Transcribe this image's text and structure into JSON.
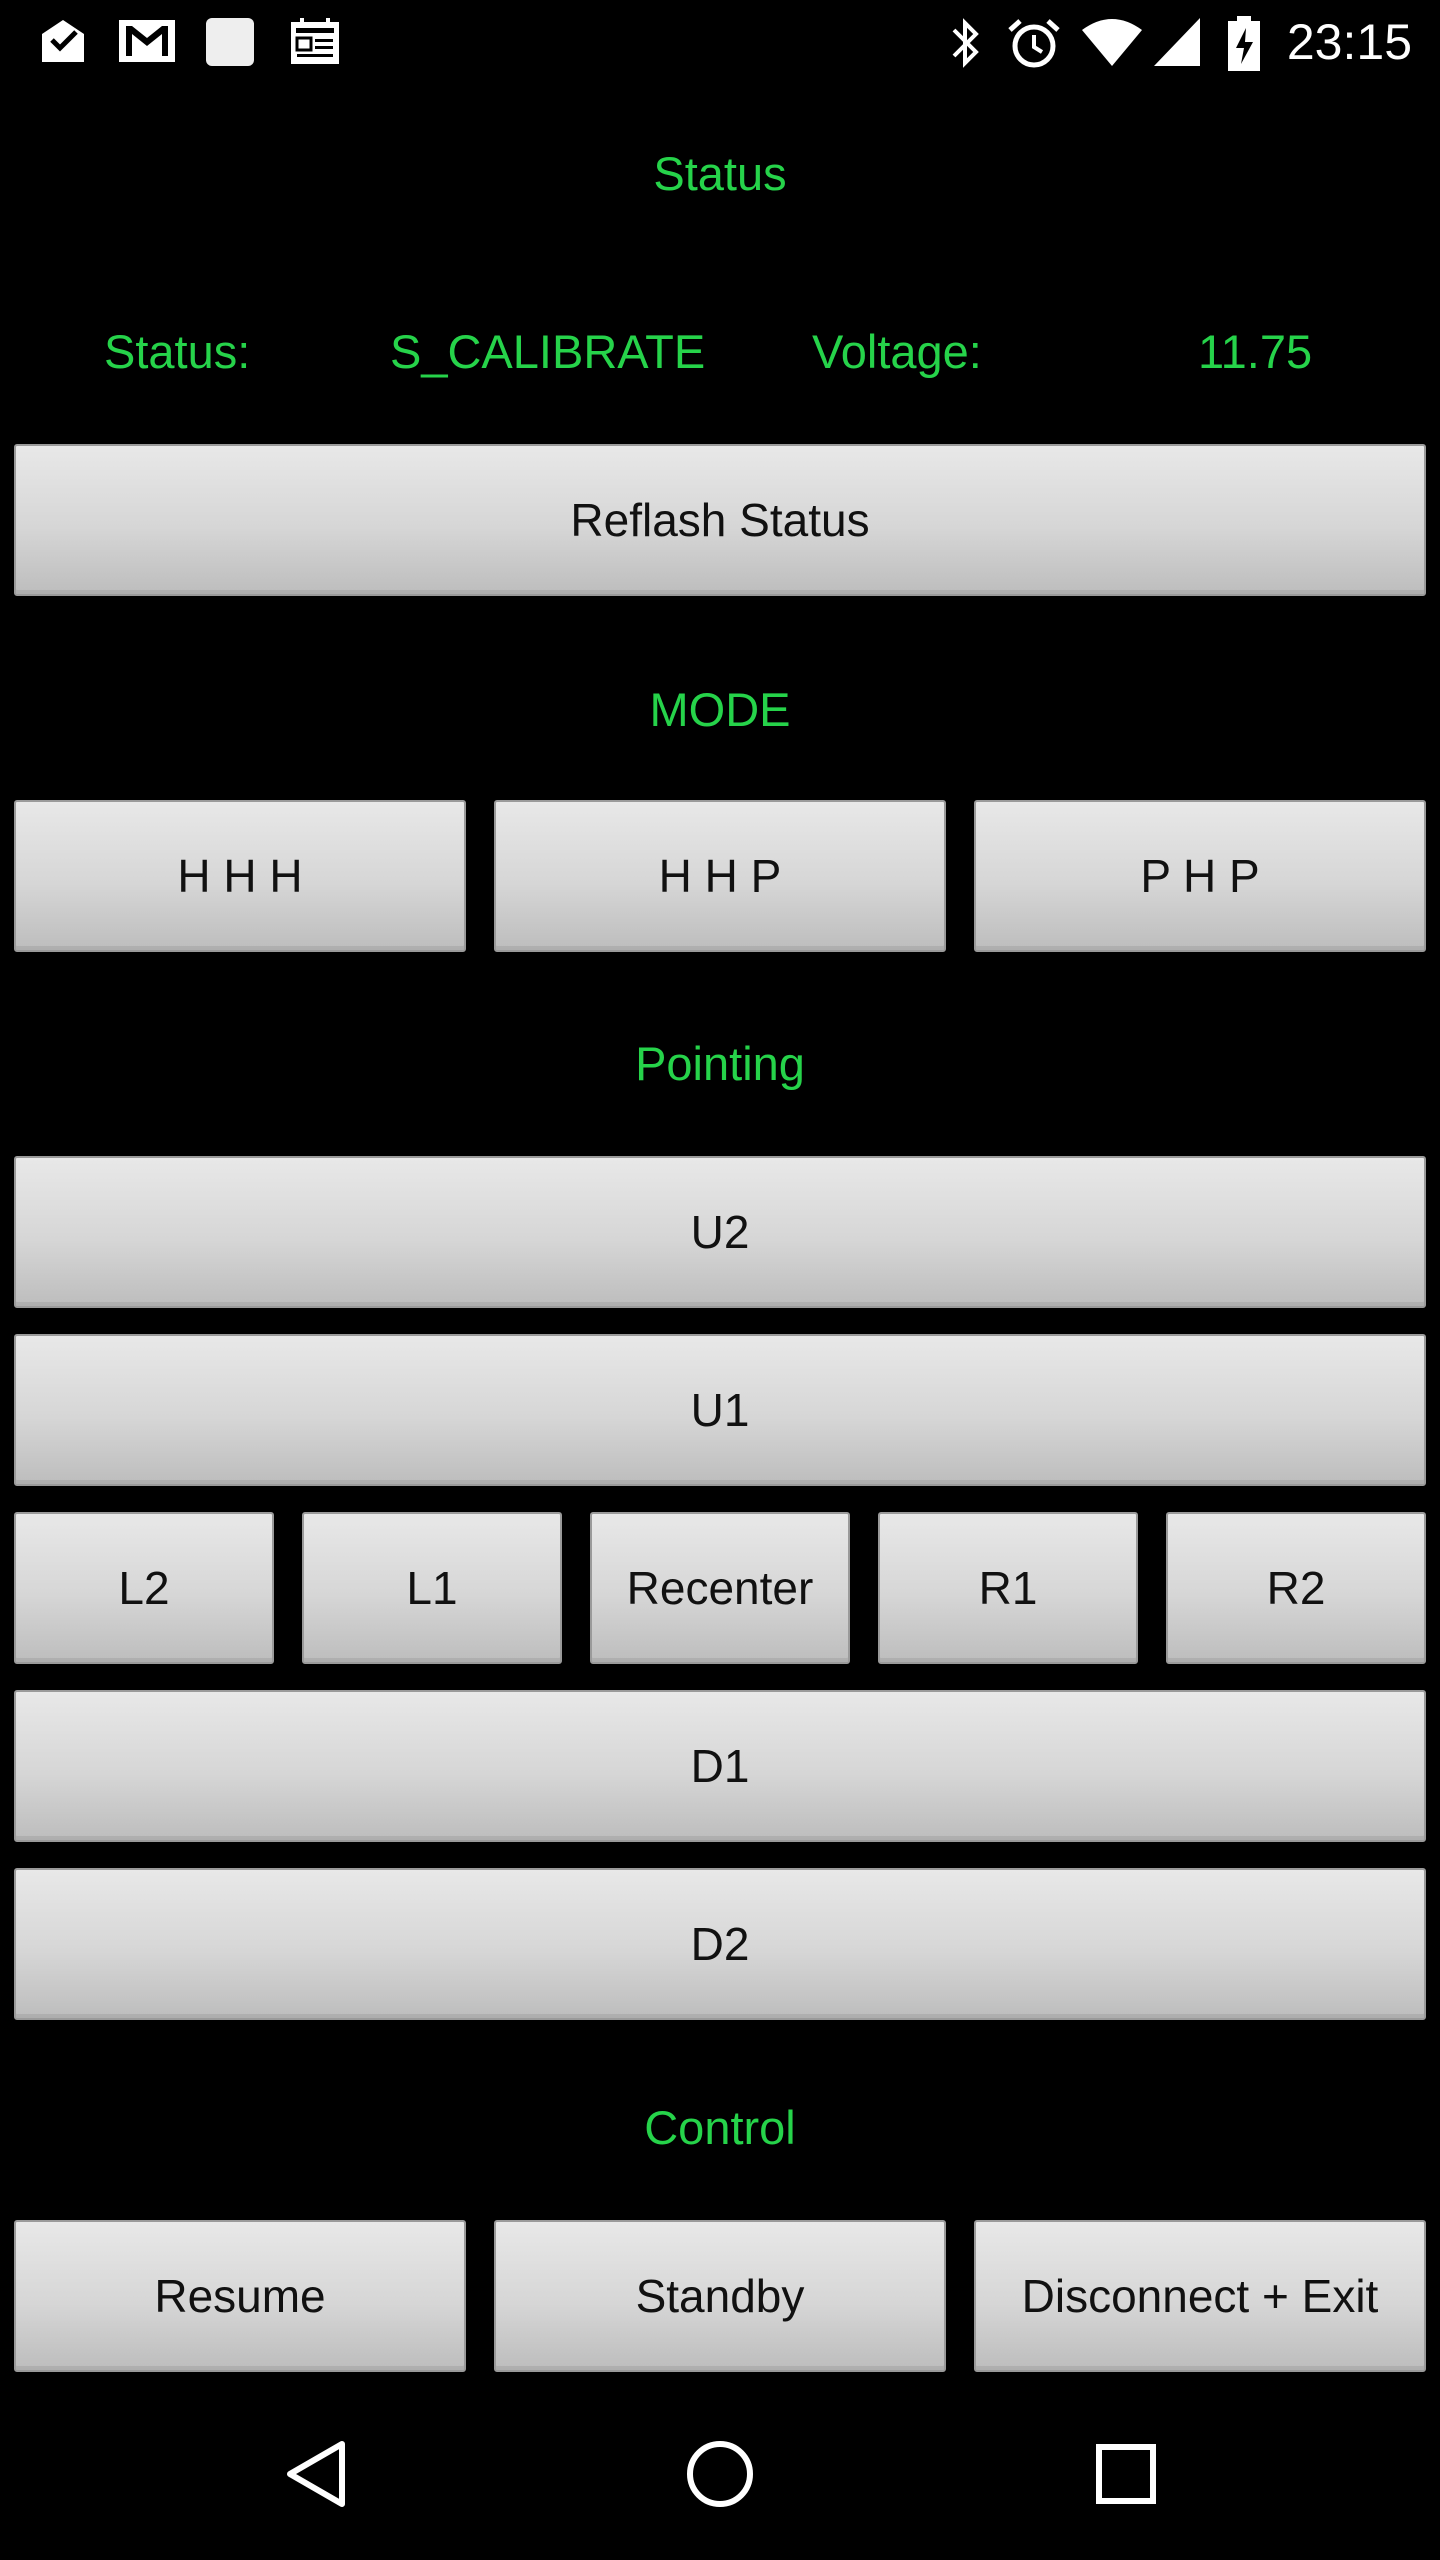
{
  "status_bar": {
    "time": "23:15",
    "left_icons": [
      "inbox-icon",
      "gmail-icon",
      "blank-notification-icon",
      "newspaper-icon"
    ],
    "right_icons": [
      "bluetooth-icon",
      "alarm-icon",
      "wifi-icon",
      "signal-icon",
      "battery-charging-icon"
    ]
  },
  "status_section": {
    "title": "Status",
    "status_label": "Status:",
    "status_value": "S_CALIBRATE",
    "voltage_label": "Voltage:",
    "voltage_value": "11.75",
    "reflash_button": "Reflash Status"
  },
  "mode_section": {
    "title": "MODE",
    "buttons": [
      "H H H",
      "H H P",
      "P H P"
    ]
  },
  "pointing_section": {
    "title": "Pointing",
    "up2": "U2",
    "up1": "U1",
    "row": [
      "L2",
      "L1",
      "Recenter",
      "R1",
      "R2"
    ],
    "down1": "D1",
    "down2": "D2"
  },
  "control_section": {
    "title": "Control",
    "buttons": [
      "Resume",
      "Standby",
      "Disconnect + Exit"
    ]
  },
  "nav_bar": {
    "icons": [
      "back-icon",
      "home-icon",
      "recents-icon"
    ]
  },
  "colors": {
    "accent_green": "#26d34a",
    "background": "#000000",
    "button_face": "#d9d9d9"
  }
}
